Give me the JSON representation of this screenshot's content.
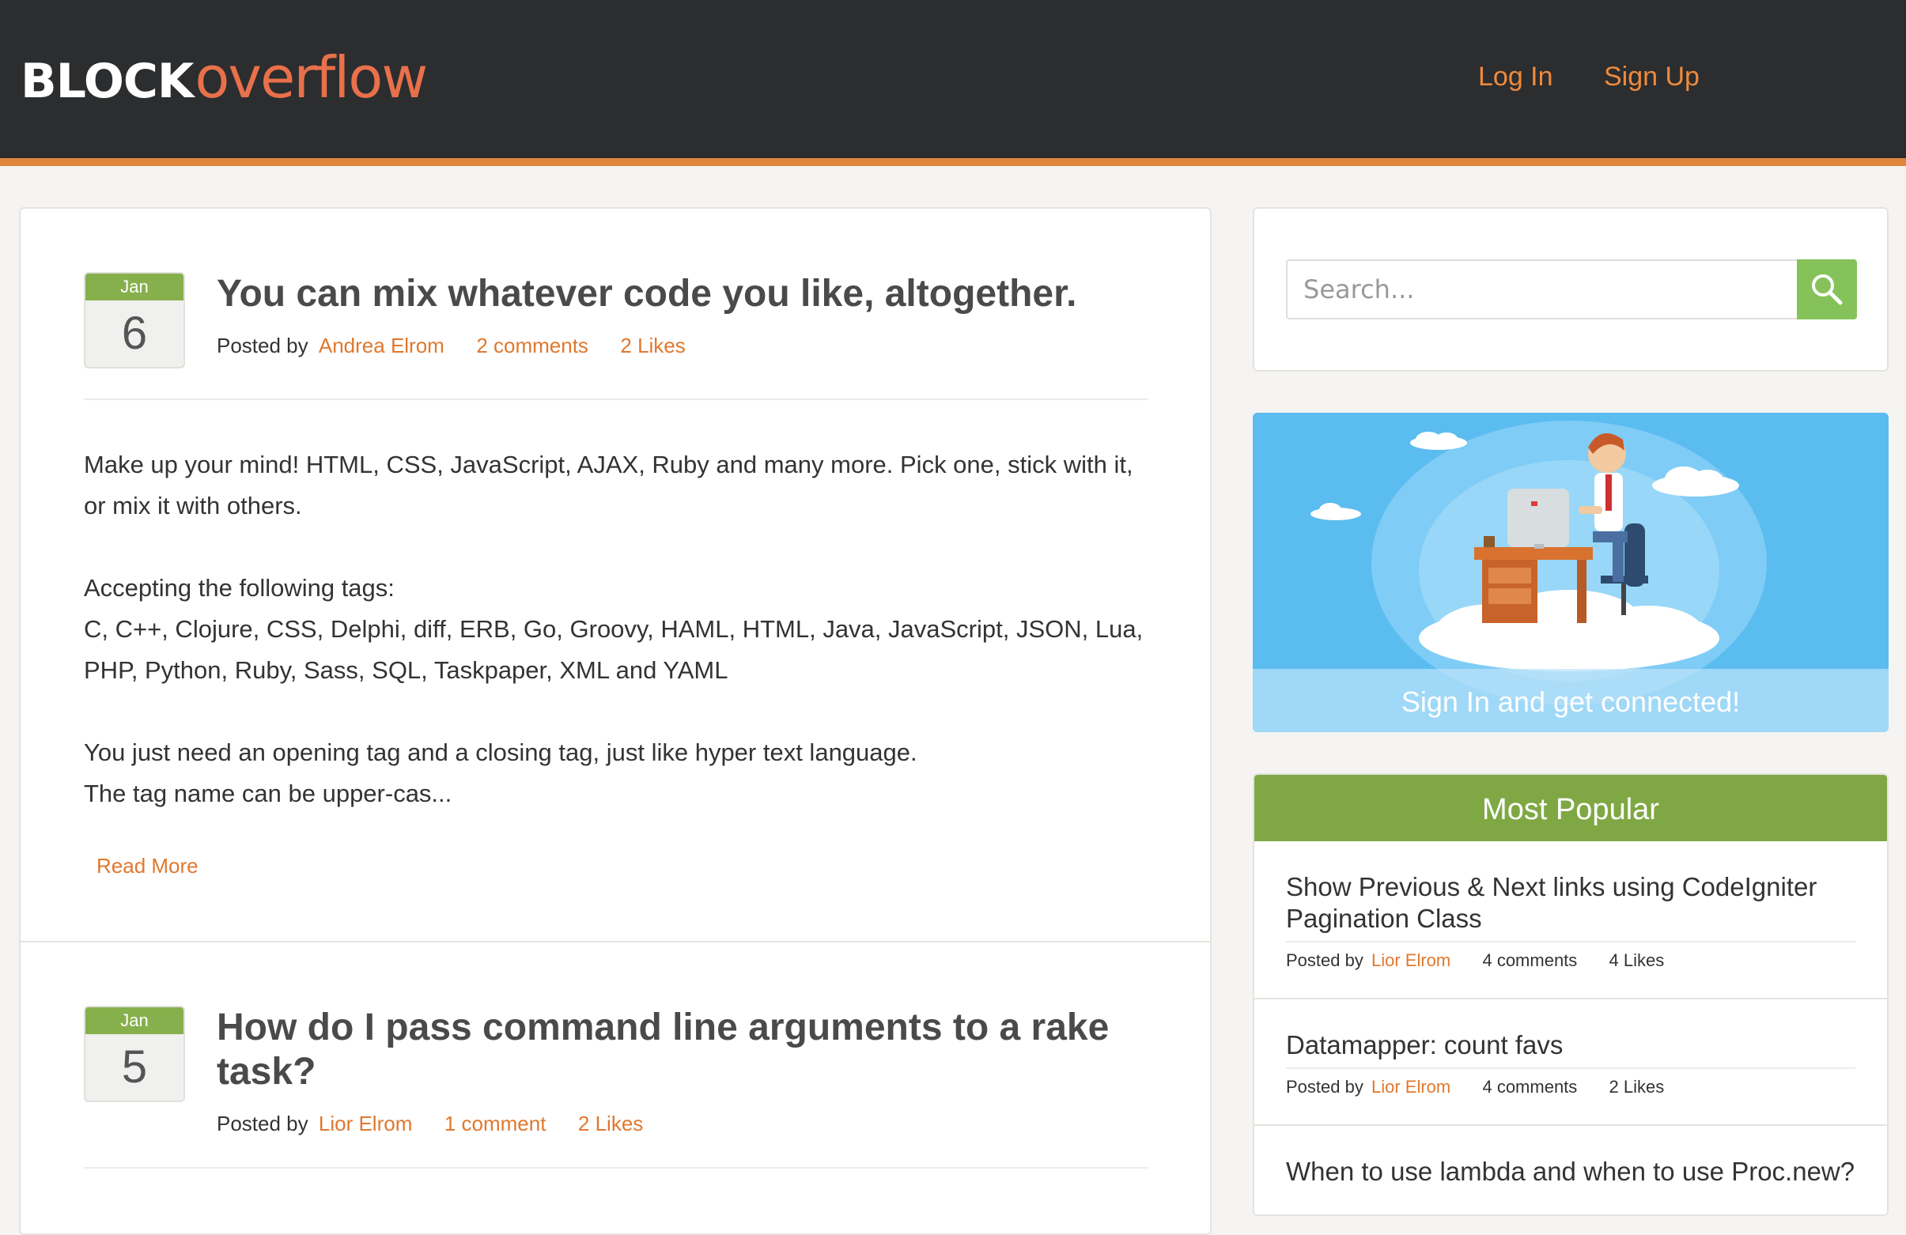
{
  "header": {
    "logo_block": "BLOCK",
    "logo_overflow": "overflow",
    "login": "Log In",
    "signup": "Sign Up"
  },
  "posts": [
    {
      "month": "Jan",
      "day": "6",
      "title": "You can mix whatever code you like, altogether.",
      "posted_by": "Posted by",
      "author": "Andrea Elrom",
      "comments": "2 comments",
      "likes": "2 Likes",
      "excerpt": [
        "Make up your mind! HTML, CSS, JavaScript, AJAX, Ruby and many more.  Pick one, stick with it, or mix it with others.",
        "Accepting the following tags:\nC, C++, Clojure, CSS, Delphi, diff, ERB, Go, Groovy, HAML, HTML, Java, JavaScript, JSON, Lua, PHP, Python, Ruby, Sass, SQL, Taskpaper, XML and YAML",
        "You just need an opening tag and a closing tag, just like hyper text language.\nThe tag name can be upper-cas..."
      ],
      "read_more": "Read More"
    },
    {
      "month": "Jan",
      "day": "5",
      "title": "How do I pass command line arguments to a rake task?",
      "posted_by": "Posted by",
      "author": "Lior Elrom",
      "comments": "1 comment",
      "likes": "2 Likes"
    }
  ],
  "sidebar": {
    "search_placeholder": "Search...",
    "promo_caption": "Sign In and get connected!",
    "popular_title": "Most Popular",
    "popular": [
      {
        "title": "Show Previous & Next links using CodeIgniter Pagination Class",
        "posted_by": "Posted by",
        "author": "Lior Elrom",
        "comments": "4 comments",
        "likes": "4 Likes"
      },
      {
        "title": "Datamapper: count favs",
        "posted_by": "Posted by",
        "author": "Lior Elrom",
        "comments": "4 comments",
        "likes": "2 Likes"
      },
      {
        "title": "When to use lambda and when to use Proc.new?"
      }
    ]
  },
  "colors": {
    "accent": "#e0843a",
    "green": "#86b04c",
    "header_bg": "#2b2d2f"
  }
}
